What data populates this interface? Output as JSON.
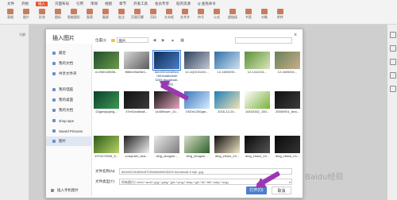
{
  "app": {
    "menu": [
      "文件",
      "开始",
      "插入",
      "页面布局",
      "引用",
      "审阅",
      "视图",
      "章节",
      "开发工具",
      "会员专享",
      "稻壳资源",
      "Q 查找命令"
    ],
    "active_menu": "插入",
    "tools": [
      "表格",
      "图片",
      "形状",
      "图标",
      "智能图形",
      "图表",
      "截屏",
      "批注",
      "页眉页脚",
      "页码",
      "文本框",
      "艺术字",
      "符号",
      "公式",
      "超链接",
      "书签",
      "对象",
      "附件"
    ],
    "left_pane_label": "大纲"
  },
  "dialog": {
    "title": "插入图片",
    "close": "×",
    "location_label": "位置(I):",
    "location_value": "图片",
    "nav_arrows": "◀ ▶ ▲ ▦",
    "sidebar": {
      "items": [
        {
          "label": "最近",
          "selected": false
        },
        {
          "label": "我的文档",
          "selected": false
        },
        {
          "label": "共享文件夹",
          "selected": false
        },
        {
          "label": "我的电脑",
          "selected": false
        },
        {
          "label": "我的桌面",
          "selected": false
        },
        {
          "label": "我的文档",
          "selected": false
        },
        {
          "label": "shop.wps",
          "selected": false
        },
        {
          "label": "Saved Pictures",
          "selected": false
        },
        {
          "label": "图片",
          "selected": true
        }
      ],
      "bottom": "插入手机图片"
    },
    "files": [
      {
        "name": "d-1960115556...",
        "colors": [
          "#1f4d2c",
          "#6d9b4b"
        ]
      },
      {
        "name": "f85ee49a06e1...",
        "colors": [
          "#d9d9d9",
          "#5b5b5b"
        ]
      },
      {
        "name": "",
        "colors": [
          "#0f2c57",
          "#4b7fc4"
        ],
        "selected": true
      },
      {
        "name": "12-1Q0101101...",
        "colors": [
          "#2b3f5c",
          "#c2c8d2"
        ]
      },
      {
        "name": "12-1609200...",
        "colors": [
          "#2f6fa8",
          "#cfe1ef"
        ]
      },
      {
        "name": "12-1412211...",
        "colors": [
          "#5d8f3a",
          "#d7e8b5"
        ]
      },
      {
        "name": "12-1609201...",
        "colors": [
          "#6b7f59",
          "#c6b18a"
        ]
      },
      {
        "name": "22ganqiuping...",
        "colors": [
          "#0a3f2a",
          "#3d9a55"
        ]
      },
      {
        "name": "37e91ea5ea8...",
        "colors": [
          "#111111",
          "#3b3b3b"
        ]
      },
      {
        "name": "1440flower_10...",
        "colors": [
          "#121212",
          "#e8a5c2"
        ]
      },
      {
        "name": "1920x1200gar...",
        "colors": [
          "#3a78bd",
          "#d8ecff"
        ]
      },
      {
        "name": "2016-12-24...",
        "colors": [
          "#1d7fb8",
          "#f3e3b5"
        ]
      },
      {
        "name": "10432342_150...",
        "colors": [
          "#ffffff",
          "#7bb13a"
        ]
      },
      {
        "name": "20060901_bea...",
        "colors": [
          "#101010",
          "#3c3c3c"
        ]
      },
      {
        "name": "1370472526_5...",
        "colors": [
          "#2b5a18",
          "#b8d467"
        ]
      },
      {
        "name": "computer_bea...",
        "colors": [
          "#1f1f1f",
          "#f1f1f1"
        ]
      },
      {
        "name": "ding_dongwe...",
        "colors": [
          "#e9e9e9",
          "#7d7d7d"
        ]
      },
      {
        "name": "ding_dongwe...",
        "colors": [
          "#d9e1c9",
          "#2c5f2a"
        ]
      },
      {
        "name": "ding_zhiwu_24...",
        "colors": [
          "#0b0b0b",
          "#efe6c5"
        ]
      },
      {
        "name": "ding_zhiwu_24...",
        "colors": [
          "#070707",
          "#555555"
        ]
      },
      {
        "name": "ding_zhiwu_24...",
        "colors": [
          "#0a0a0a",
          "#333333"
        ]
      }
    ],
    "selected_filename_lines": [
      "8eb0001816f6e4",
      "7f0f34d8b0b50",
      "5209-thumbnail-",
      "kdg4.jpg"
    ],
    "filename_label": "文件名称(N):",
    "filename_value": "8eb0001816f6e4f70f34d8b0b505209-thumbnail-5 kqb .jpg",
    "filetype_label": "文件类型(T):",
    "filetype_value": "所有图片(*.emf;*.wmf;*.jpg;*.jpeg;*.jpe;*.png;*.bmp;*.gif;*.tif;*.tiff;*.wdp;*.svg)",
    "open_button": "打开(O)",
    "cancel_button": "取消",
    "accent_color": "#4a7fcf"
  },
  "watermark": "Baidu经验"
}
